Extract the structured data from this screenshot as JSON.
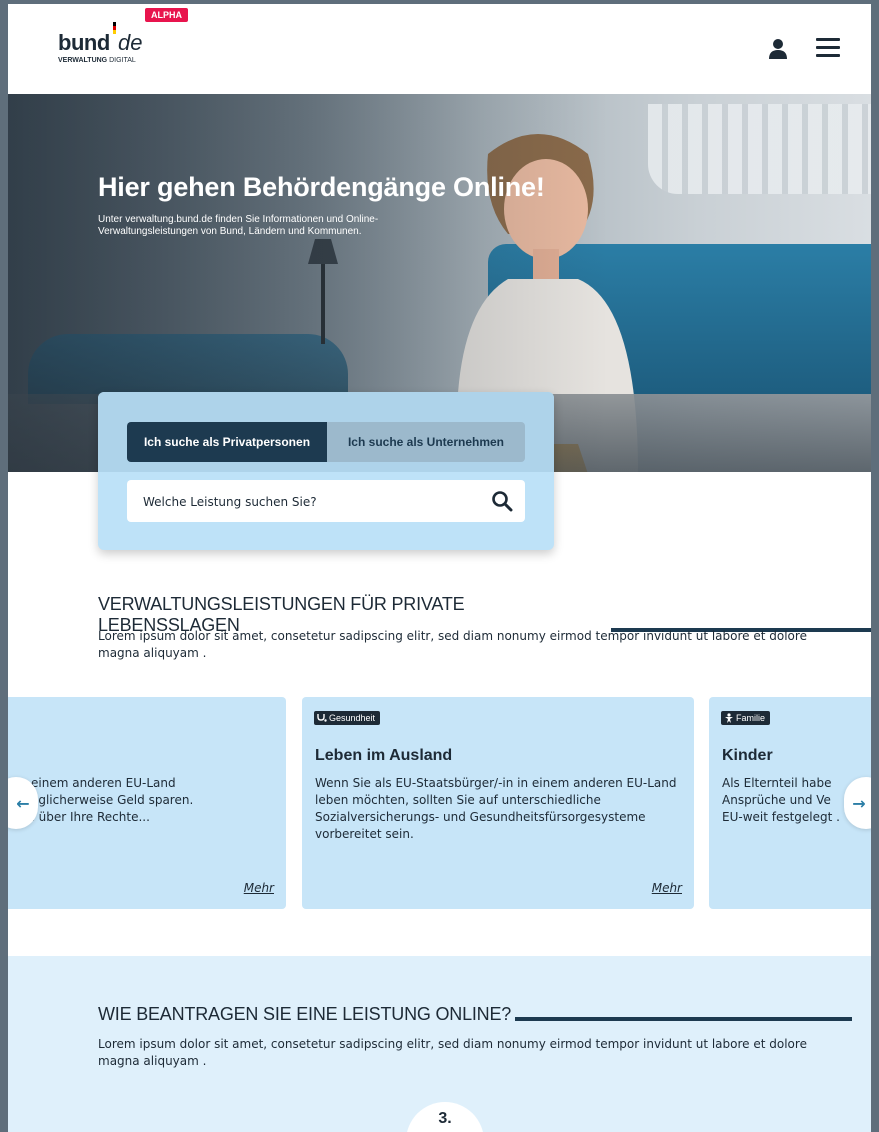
{
  "header": {
    "logo_alpha": "ALPHA",
    "logo_bund": "bund",
    "logo_de": "de",
    "logo_sub_bold": "VERWALTUNG",
    "logo_sub_light": " DIGITAL",
    "icons": [
      "user-icon",
      "menu-icon"
    ]
  },
  "hero": {
    "title": "Hier gehen Behördengänge Online!",
    "text": "Unter verwaltung.bund.de finden Sie Informationen und Online-Verwaltungsleistungen von Bund, Ländern und Kommunen."
  },
  "search": {
    "tab_private": "Ich suche als Privatpersonen",
    "tab_business": "Ich suche als Unternehmen",
    "placeholder": "Welche Leistung suchen Sie?"
  },
  "section_private": {
    "heading": "VERWALTUNGSLEISTUNGEN FÜR PRIVATE LEBENSSLAGEN",
    "text": "Lorem ipsum dolor sit amet, consetetur sadipscing elitr, sed diam nonumy eirmod tempor invidunt ut labore et dolore magna aliquyam ."
  },
  "cards": [
    {
      "category": "",
      "title": "",
      "text": "einem anderen EU-Land\nöglicherweise Geld sparen.\n. über Ihre Rechte...",
      "more": "Mehr"
    },
    {
      "category": "Gesundheit",
      "title": "Leben im Ausland",
      "text": "Wenn Sie als EU-Staatsbürger/-in in einem anderen EU-Land leben möchten, sollten Sie auf unterschiedliche Sozialversicherungs- und Gesundheitsfürsorgesysteme vorbereitet sein.",
      "more": "Mehr"
    },
    {
      "category": "Familie",
      "title": "Kinder",
      "text": "Als Elternteil habe\nAnsprüche und Ve\nEU-weit festgelegt .",
      "more": ""
    }
  ],
  "carousel": {
    "prev": "←",
    "next": "→"
  },
  "section_apply": {
    "heading": "WIE BEANTRAGEN SIE EINE LEISTUNG ONLINE?",
    "text": "Lorem ipsum dolor sit amet, consetetur sadipscing elitr, sed diam nonumy eirmod tempor invidunt ut labore et dolore magna aliquyam .",
    "step": "3."
  },
  "colors": {
    "navy": "#1d3a50",
    "card_bg": "#c7e5f8",
    "search_bg": "#bee2f8",
    "alpha_red": "#e8144d",
    "lower_bg": "#dff0fb"
  }
}
